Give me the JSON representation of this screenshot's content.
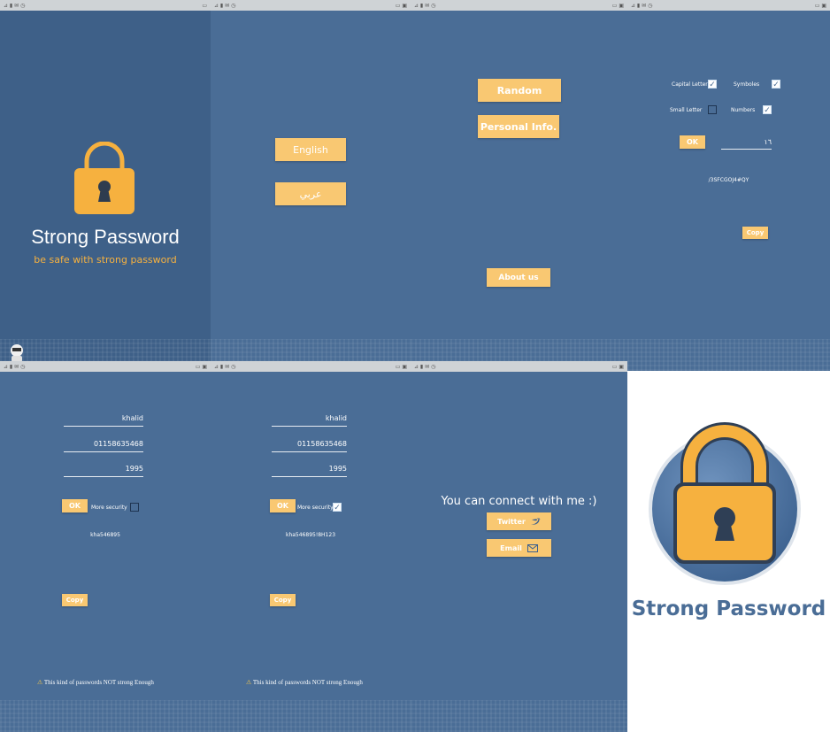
{
  "status_time": "٢:٥٦",
  "splash": {
    "title": "Strong Password",
    "subtitle": "be safe with strong password"
  },
  "language": {
    "english": "English",
    "arabic": "عربي"
  },
  "menu": {
    "random": "Random",
    "personal": "Personal Info.",
    "about": "About us"
  },
  "random": {
    "capital": "Capital Letter",
    "symbols": "Symboles",
    "small": "Small Letter",
    "numbers": "Numbers",
    "ok": "OK",
    "length": "١٦",
    "result": "/3SFCGOJ4#QY",
    "copy": "Copy"
  },
  "personal_a": {
    "name": "khalid",
    "phone": "01158635468",
    "year": "1995",
    "ok": "OK",
    "more_security": "More security",
    "result": "kha546895",
    "copy": "Copy",
    "warning": "This kind of passwords NOT strong Enough"
  },
  "personal_b": {
    "name": "khalid",
    "phone": "01158635468",
    "year": "1995",
    "ok": "OK",
    "more_security": "More security",
    "result": "kha546895!8H123",
    "copy": "Copy",
    "warning": "This kind of passwords NOT strong Enough"
  },
  "contact": {
    "heading": "You can connect with me :)",
    "twitter": "Twitter",
    "email": "Email"
  },
  "logo": {
    "title": "Strong Password"
  }
}
